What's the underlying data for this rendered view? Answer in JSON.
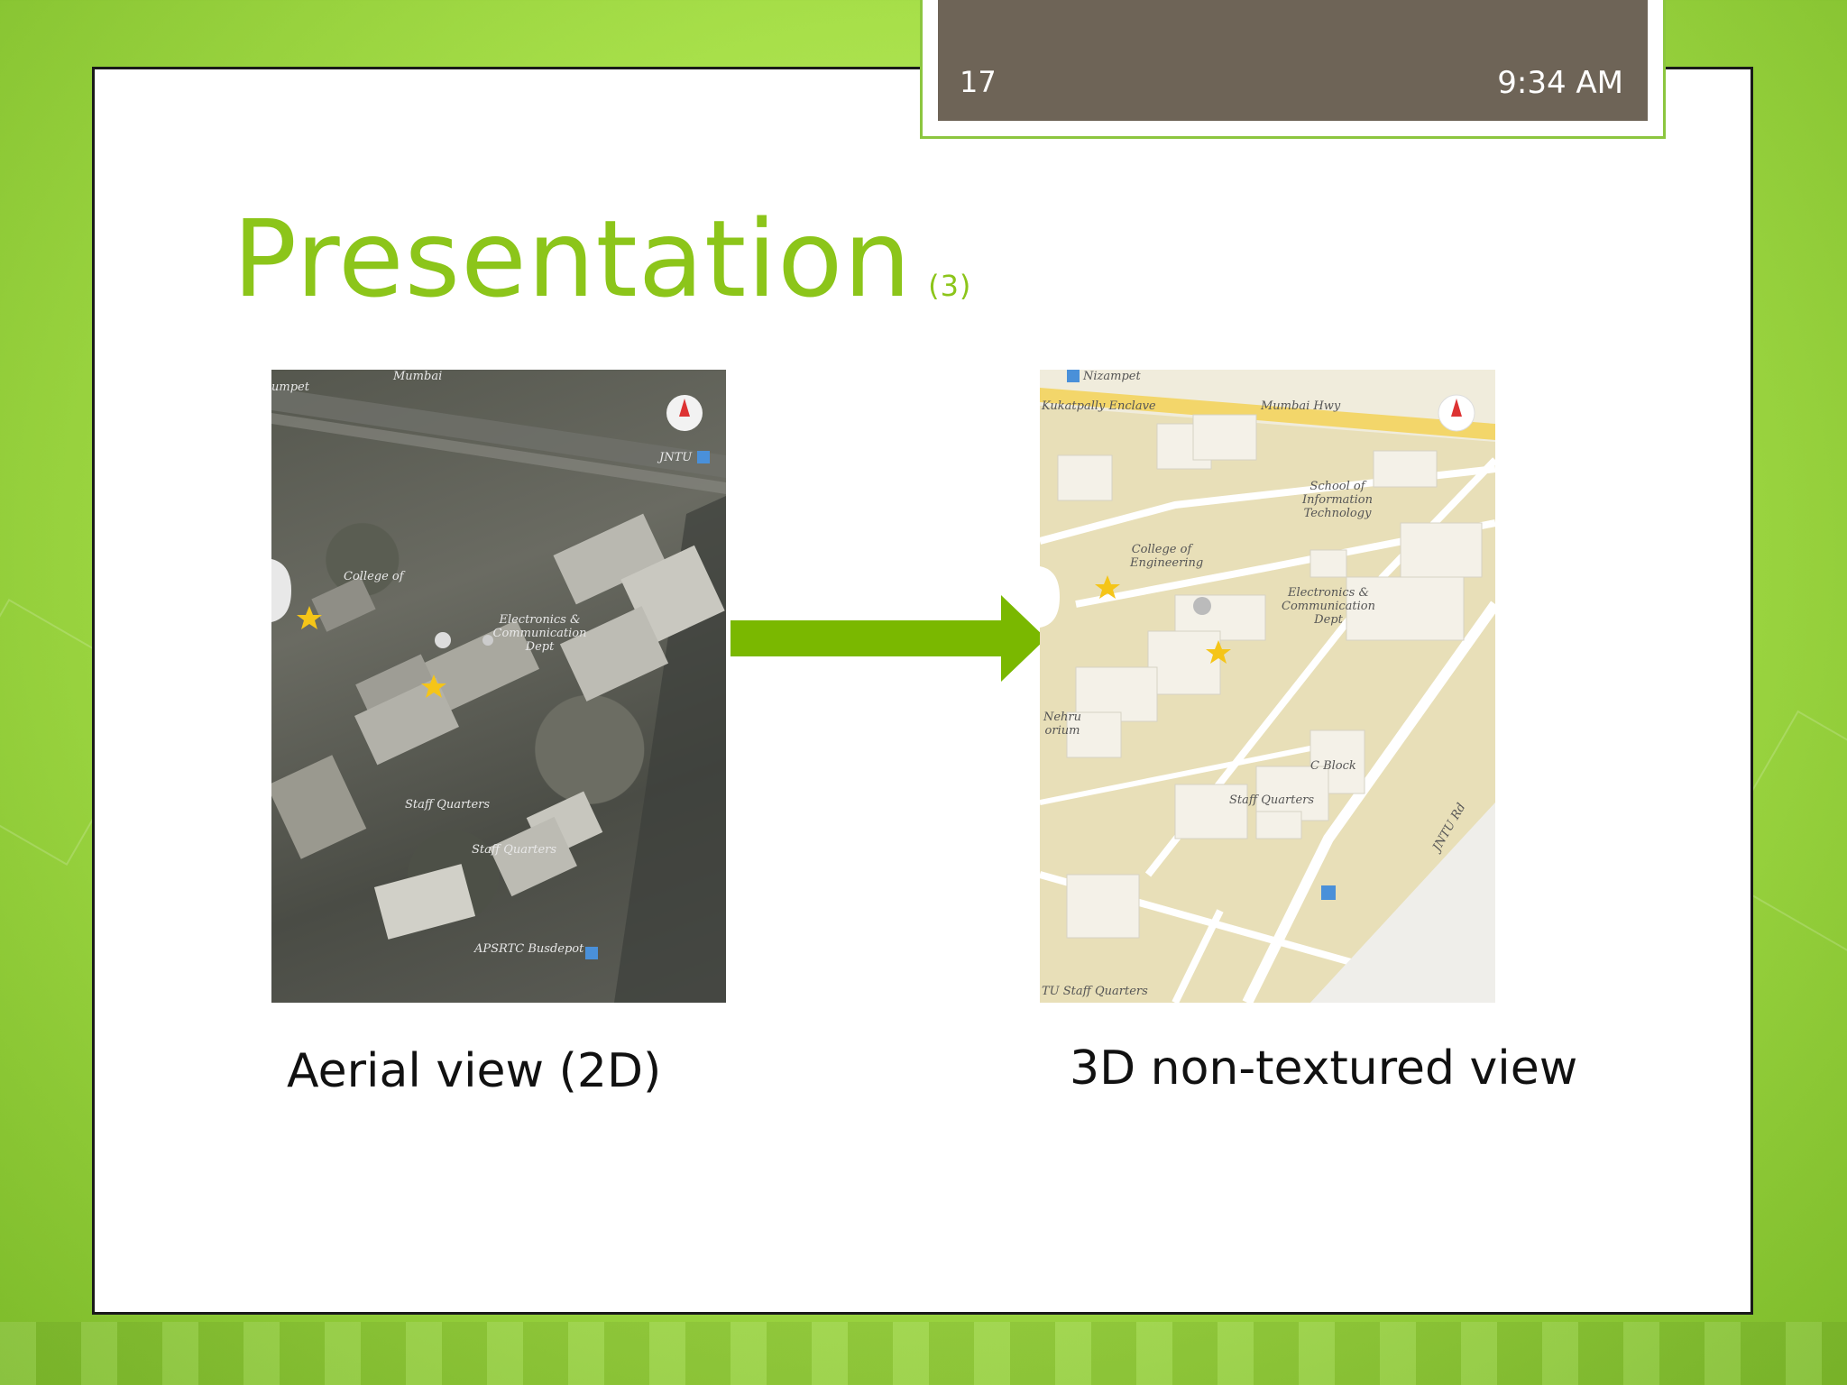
{
  "slide": {
    "number": "17",
    "time": "9:34 AM",
    "title": "Presentation",
    "title_suffix": "(3)"
  },
  "left_panel": {
    "caption": "Aerial view (2D)",
    "labels": {
      "top_left": "umpet",
      "top_road": "Mumbai",
      "jntu": "JNTU",
      "college": "College of",
      "ece": "Electronics & Communication Dept",
      "staff1": "Staff Quarters",
      "staff2": "Staff Quarters",
      "apsrtc": "APSRTC Busdepot"
    }
  },
  "right_panel": {
    "caption": "3D non-textured view",
    "labels": {
      "nizampet": "Nizampet",
      "kukatpally": "Kukatpally Enclave",
      "mumbai_hwy": "Mumbai Hwy",
      "school": "School of Information Technology",
      "college": "College of Engineering",
      "ece": "Electronics & Communication Dept",
      "nehru": "Nehru orium",
      "cblock": "C Block",
      "staff": "Staff Quarters",
      "jntu_rd": "JNTU Rd",
      "staff_bottom": "TU Staff Quarters"
    }
  },
  "colors": {
    "title": "#8cc51a",
    "arrow": "#7ab800",
    "header": "#6e6457",
    "header_border": "#8cc63f"
  }
}
